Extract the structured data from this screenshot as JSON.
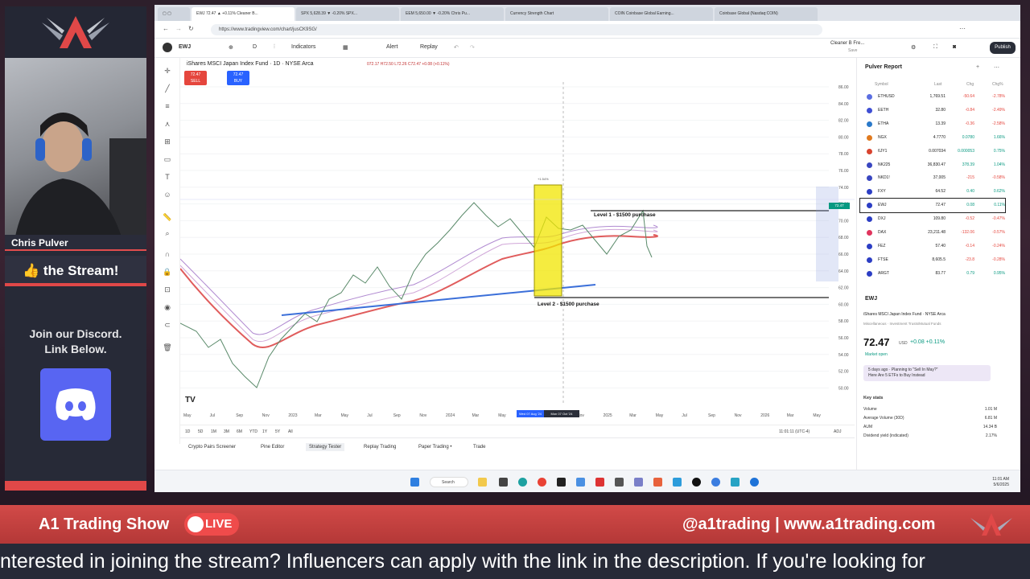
{
  "stream": {
    "host_name": "Chris Pulver",
    "thumb_text": "👍 the Stream!",
    "discord_line1": "Join our Discord.",
    "discord_line2": "Link Below.",
    "show_title": "A1 Trading Show",
    "live_label": "LIVE",
    "handle": "@a1trading | www.a1trading.com",
    "ticker": "nterested in joining the stream? Influencers can apply with the link in the description. If you're looking for"
  },
  "browser": {
    "tabs": [
      "EWJ 72.47 ▲ +0.11% Cleaner B...",
      "SPX 5,628.39 ▼ -0.20% SPX...",
      "EEM 5,650.00 ▼ -0.20% Chris Pu...",
      "Currency Strength Chart",
      "COIN Coinbase Global Earning...",
      "Coinbase Global (Nasdaq:COIN)"
    ],
    "url": "https://www.tradingview.com/chart/jusCK9SG/"
  },
  "toolbar": {
    "symbol": "EWJ",
    "indicators": "Indicators",
    "alert": "Alert",
    "replay": "Replay",
    "layout_name": "Cleaner B Fre...",
    "layout_sub": "Save",
    "publish": "Publish"
  },
  "chart": {
    "title": "iShares MSCI Japan Index Fund · 1D · NYSE Arca",
    "ohlc": "072.17 H72.50 L72.26 C72.47 +0.08 (+0.11%)",
    "sell_price": "72.47",
    "sell_label": "SELL",
    "buy_price": "72.47",
    "buy_label": "BUY",
    "level1": "Level 1 - $1500 purchase",
    "level2": "Level 2 - $1500 purchase",
    "range_label": "+1.54%",
    "y_ticks": [
      "86.00",
      "84.00",
      "82.00",
      "80.00",
      "78.00",
      "76.00",
      "74.00",
      "72.00",
      "70.00",
      "68.00",
      "66.00",
      "64.00",
      "62.00",
      "60.00",
      "58.00",
      "56.00",
      "54.00",
      "52.00",
      "50.00"
    ],
    "x_ticks": [
      "May",
      "Jul",
      "Sep",
      "Nov",
      "2023",
      "Mar",
      "May",
      "Jul",
      "Sep",
      "Nov",
      "2024",
      "Mar",
      "May",
      "Jul",
      "Sep",
      "Nov",
      "2025",
      "Mar",
      "May",
      "Jul",
      "Sep",
      "Nov",
      "2026",
      "Mar",
      "May"
    ],
    "date_badge_1": "Wed 07 Aug '24",
    "date_badge_2": "Mon 07 Oct '24",
    "price_badge": "72.47"
  },
  "timeframes": [
    "1D",
    "5D",
    "1M",
    "3M",
    "6M",
    "YTD",
    "1Y",
    "5Y",
    "All"
  ],
  "time_readout": "11:01:11 (UTC-4)",
  "adj_label": "ADJ",
  "bottom_tabs": [
    "Crypto Pairs Screener",
    "Pine Editor",
    "Strategy Tester",
    "Replay Trading",
    "Paper Trading •",
    "Trade"
  ],
  "watchlist": {
    "title": "Pulver Report",
    "headers": [
      "Symbol",
      "Last",
      "Chg",
      "Chg%"
    ],
    "rows": [
      {
        "s": "ETHUSD",
        "l": "1,769.51",
        "c": "-50.64",
        "p": "-2.78%",
        "col": "#5b6ee1"
      },
      {
        "s": "EETH",
        "l": "32.80",
        "c": "-0.84",
        "p": "-2.49%",
        "col": "#3f4fd4"
      },
      {
        "s": "ETHA",
        "l": "13.39",
        "c": "-0.36",
        "p": "-2.58%",
        "col": "#2a79c9"
      },
      {
        "s": "NGX",
        "l": "4.7770",
        "c": "0.0780",
        "p": "1.66%",
        "col": "#e07a1f"
      },
      {
        "s": "6JY1",
        "l": "0.007034",
        "c": "0.000053",
        "p": "0.75%",
        "col": "#d8442f"
      },
      {
        "s": "NK225",
        "l": "36,830.47",
        "c": "378.39",
        "p": "1.04%",
        "col": "#3946c0"
      },
      {
        "s": "NKD1!",
        "l": "37,005",
        "c": "-215",
        "p": "-0.58%",
        "col": "#3946c0"
      },
      {
        "s": "FXY",
        "l": "64.52",
        "c": "0.40",
        "p": "0.62%",
        "col": "#2c3ec4"
      },
      {
        "s": "EWJ",
        "l": "72.47",
        "c": "0.08",
        "p": "0.11%",
        "col": "#2c3ec4"
      },
      {
        "s": "DXJ",
        "l": "109.80",
        "c": "-0.52",
        "p": "-0.47%",
        "col": "#2c3ec4"
      },
      {
        "s": "DAX",
        "l": "23,211.48",
        "c": "-132.06",
        "p": "-0.57%",
        "col": "#e0345d"
      },
      {
        "s": "FEZ",
        "l": "57.40",
        "c": "-0.14",
        "p": "-0.24%",
        "col": "#2c3ec4"
      },
      {
        "s": "FTSE",
        "l": "8,605.5",
        "c": "-23.8",
        "p": "-0.28%",
        "col": "#2c3ec4"
      },
      {
        "s": "ARGT",
        "l": "83.77",
        "c": "0.79",
        "p": "0.95%",
        "col": "#2c3ec4"
      }
    ]
  },
  "details": {
    "symbol": "EWJ",
    "name": "iShares MSCI Japan Index Fund",
    "exchange": "NYSE Arca",
    "category": "Miscellaneous · Investment Trusts/Mutual Funds",
    "price": "72.47",
    "currency": "USD",
    "change": "+0.08 +0.11%",
    "market": "Market open",
    "banner_line1": "5 days ago · Planning to \"Sell In May?\"",
    "banner_line2": "Here Are 5 ETFs to Buy Instead",
    "stats_title": "Key stats",
    "stats": [
      {
        "k": "Volume",
        "v": "1.01 M"
      },
      {
        "k": "Average Volume (30D)",
        "v": "6.81 M"
      },
      {
        "k": "AUM",
        "v": "14.34 B"
      },
      {
        "k": "Dividend yield (indicated)",
        "v": "2.17%"
      }
    ]
  },
  "clock": {
    "time": "11:01 AM",
    "date": "5/6/2025"
  },
  "search_label": "Search"
}
